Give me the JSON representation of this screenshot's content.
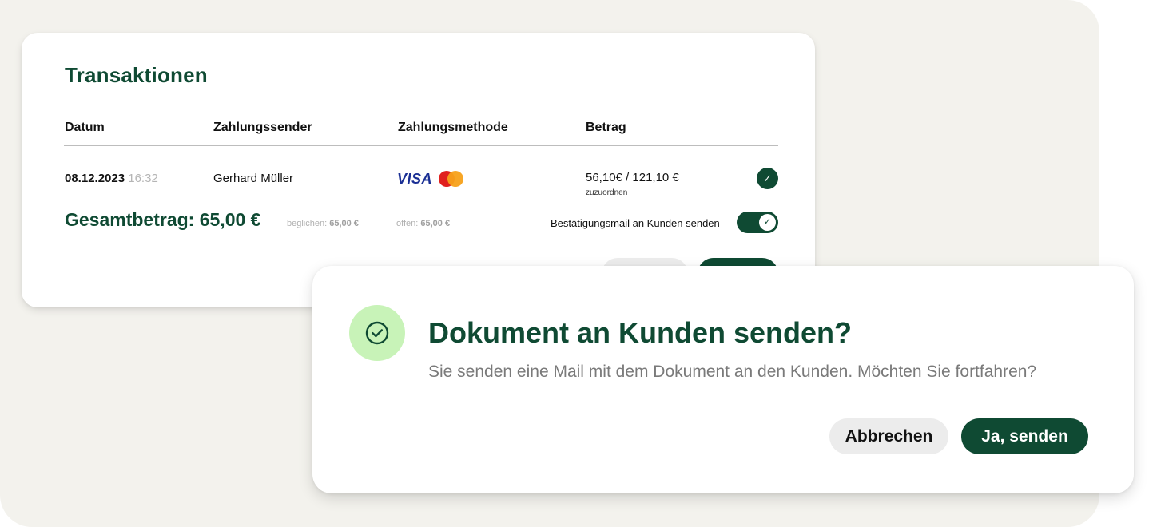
{
  "transactions": {
    "title": "Transaktionen",
    "headers": {
      "datum": "Datum",
      "sender": "Zahlungssender",
      "method": "Zahlungsmethode",
      "amount": "Betrag"
    },
    "row": {
      "date": "08.12.2023",
      "time": "16:32",
      "sender": "Gerhard Müller",
      "payment_brands": [
        "VISA",
        "mastercard"
      ],
      "visa_label": "VISA",
      "amount": "56,10€ / 121,10 €",
      "amount_note": "zuzuordnen",
      "status_icon": "check-icon"
    },
    "total": "Gesamtbetrag: 65,00 €",
    "settled_label": "beglichen:",
    "settled_value": "65,00 €",
    "open_label": "offen:",
    "open_value": "65,00 €",
    "confirm_mail_label": "Bestätigungsmail an Kunden senden",
    "confirm_mail_enabled": true
  },
  "modal": {
    "icon": "check-circle-icon",
    "title": "Dokument an Kunden senden?",
    "message": "Sie senden eine Mail mit dem Dokument an den Kunden. Möchten Sie fortfahren?",
    "cancel_label": "Abbrechen",
    "confirm_label": "Ja, senden"
  },
  "colors": {
    "brand_green": "#0f4a33",
    "icon_bg": "#c8f3b8",
    "background": "#f3f2ed",
    "muted_text": "#7a7a7a"
  }
}
